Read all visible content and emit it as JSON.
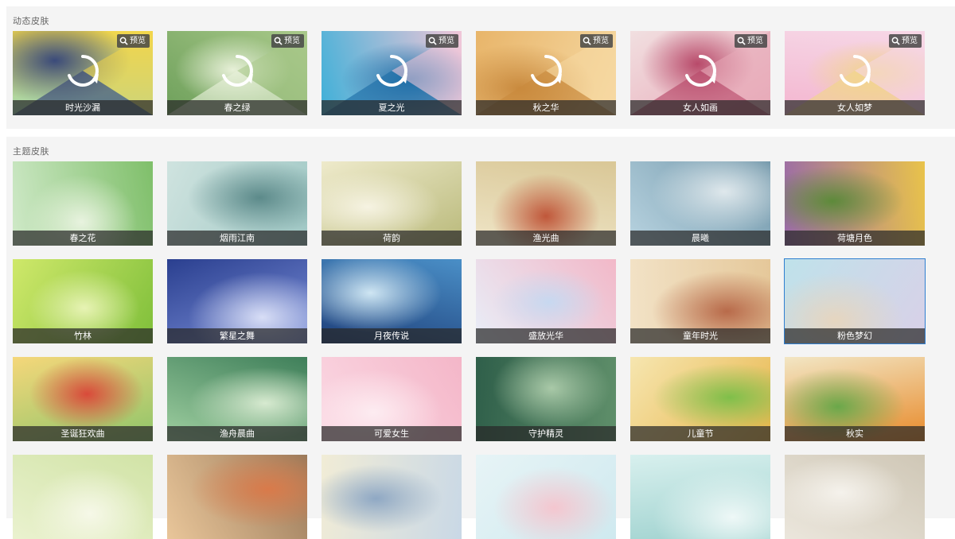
{
  "dynamic_section": {
    "title": "动态皮肤",
    "preview_label": "预览",
    "skins": [
      {
        "name": "时光沙漏",
        "colors": [
          "#9fd6b5",
          "#f2d64a",
          "#3a4a7a"
        ]
      },
      {
        "name": "春之绿",
        "colors": [
          "#6ea05b",
          "#a9c98a",
          "#e7f0d8"
        ]
      },
      {
        "name": "夏之光",
        "colors": [
          "#3fb0d8",
          "#f0c6d8",
          "#1e6fa8"
        ]
      },
      {
        "name": "秋之华",
        "colors": [
          "#e8b56a",
          "#f6d9a3",
          "#c98a3e"
        ]
      },
      {
        "name": "女人如画",
        "colors": [
          "#f1dfe0",
          "#e8a9b8",
          "#b84a6a"
        ]
      },
      {
        "name": "女人如梦",
        "colors": [
          "#f3b5cf",
          "#f6d7e6",
          "#f1d58a"
        ]
      }
    ]
  },
  "theme_section": {
    "title": "主题皮肤",
    "skins": [
      {
        "name": "春之花",
        "colors": [
          "#cfe9c8",
          "#7fbf6a",
          "#e8f3df"
        ]
      },
      {
        "name": "烟雨江南",
        "colors": [
          "#cfe3df",
          "#9fc7c4",
          "#5c8a8a"
        ]
      },
      {
        "name": "荷韵",
        "colors": [
          "#eeeacb",
          "#b9b97a",
          "#f6f3e2"
        ]
      },
      {
        "name": "渔光曲",
        "colors": [
          "#efe5c7",
          "#d9c796",
          "#c0573a"
        ]
      },
      {
        "name": "晨曦",
        "colors": [
          "#b8d3e0",
          "#6f95a8",
          "#dfe8ec"
        ]
      },
      {
        "name": "荷塘月色",
        "colors": [
          "#9a6aa8",
          "#e9c34a",
          "#5d8a3a"
        ]
      },
      {
        "name": "竹林",
        "colors": [
          "#cfe86a",
          "#7fbf3a",
          "#e7f3b4"
        ]
      },
      {
        "name": "繁星之舞",
        "colors": [
          "#2a3f8f",
          "#7b8fd9",
          "#d8def6"
        ]
      },
      {
        "name": "月夜传说",
        "colors": [
          "#1e3f7a",
          "#4a8fc7",
          "#cfe6f3"
        ]
      },
      {
        "name": "盛放光华",
        "colors": [
          "#e8eef8",
          "#f2b8c8",
          "#c7d8f0"
        ]
      },
      {
        "name": "童年时光",
        "colors": [
          "#f2e2c6",
          "#e5c89a",
          "#b86a4a"
        ]
      },
      {
        "name": "粉色梦幻",
        "colors": [
          "#bfe2ea",
          "#d9d0e8",
          "#e6d6bf"
        ]
      },
      {
        "name": "圣诞狂欢曲",
        "colors": [
          "#f5d77a",
          "#8fc56a",
          "#d94a3a"
        ]
      },
      {
        "name": "渔舟晨曲",
        "colors": [
          "#9fcfa0",
          "#3f7f5a",
          "#d7ead0"
        ]
      },
      {
        "name": "可爱女生",
        "colors": [
          "#fbd9e4",
          "#f4b6c8",
          "#fdecf1"
        ]
      },
      {
        "name": "守护精灵",
        "colors": [
          "#2f5f4a",
          "#5f8f6a",
          "#a9c9a8"
        ]
      },
      {
        "name": "儿童节",
        "colors": [
          "#f6e6b0",
          "#e8b54a",
          "#7fbf4a"
        ]
      },
      {
        "name": "秋实",
        "colors": [
          "#f2e6c4",
          "#e88a2a",
          "#6aa84a"
        ]
      },
      {
        "name": "",
        "colors": [
          "#eaf2cf",
          "#d1e3a6",
          "#f6f8e8"
        ]
      },
      {
        "name": "",
        "colors": [
          "#e9c69a",
          "#9a7a5a",
          "#d97a4a"
        ]
      },
      {
        "name": "",
        "colors": [
          "#f1ecd6",
          "#c9d8e6",
          "#8fa8c4"
        ]
      },
      {
        "name": "",
        "colors": [
          "#e7f4f6",
          "#cfe9ef",
          "#f4c6cf"
        ]
      },
      {
        "name": "",
        "colors": [
          "#d8f0ee",
          "#9fd2cf",
          "#eef8f7"
        ]
      },
      {
        "name": "",
        "colors": [
          "#ebe6dc",
          "#cfc7b6",
          "#f5f2ec"
        ]
      }
    ]
  }
}
